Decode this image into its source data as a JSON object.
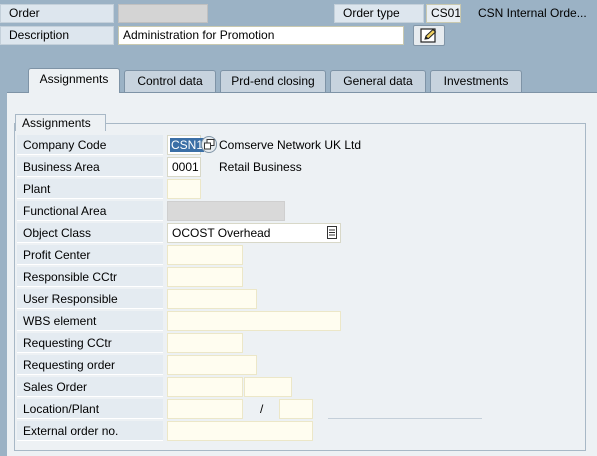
{
  "header": {
    "order_label": "Order",
    "order_value": "",
    "order_type_label": "Order type",
    "order_type_value": "CS01",
    "order_type_text": "CSN Internal Orde...",
    "description_label": "Description",
    "description_value": "Administration for Promotion",
    "edit_icon": "edit-pencil-icon"
  },
  "tabs": [
    {
      "label": "Assignments",
      "active": true
    },
    {
      "label": "Control data",
      "active": false
    },
    {
      "label": "Prd-end closing",
      "active": false
    },
    {
      "label": "General data",
      "active": false
    },
    {
      "label": "Investments",
      "active": false
    }
  ],
  "group": {
    "title": "Assignments",
    "rows": [
      {
        "label": "Company Code",
        "value": "CSN1",
        "text": "Comserve Network UK Ltd"
      },
      {
        "label": "Business Area",
        "value": "0001",
        "text": "Retail Business"
      },
      {
        "label": "Plant",
        "value": ""
      },
      {
        "label": "Functional Area",
        "value": ""
      },
      {
        "label": "Object Class",
        "value": "OCOST Overhead"
      },
      {
        "label": "Profit Center",
        "value": ""
      },
      {
        "label": "Responsible CCtr",
        "value": ""
      },
      {
        "label": "User Responsible",
        "value": ""
      },
      {
        "label": "WBS element",
        "value": ""
      },
      {
        "label": "Requesting CCtr",
        "value": ""
      },
      {
        "label": "Requesting order",
        "value": ""
      },
      {
        "label": "Sales Order",
        "value": "",
        "value2": ""
      },
      {
        "label": "Location/Plant",
        "value": "",
        "separator": "/",
        "value2": ""
      },
      {
        "label": "External order no.",
        "value": ""
      }
    ]
  },
  "colors": {
    "background": "#9bb2c5",
    "panel": "#edf1f4",
    "input_required": "#fffdf0",
    "selected_text_bg": "#3b6fa6"
  }
}
